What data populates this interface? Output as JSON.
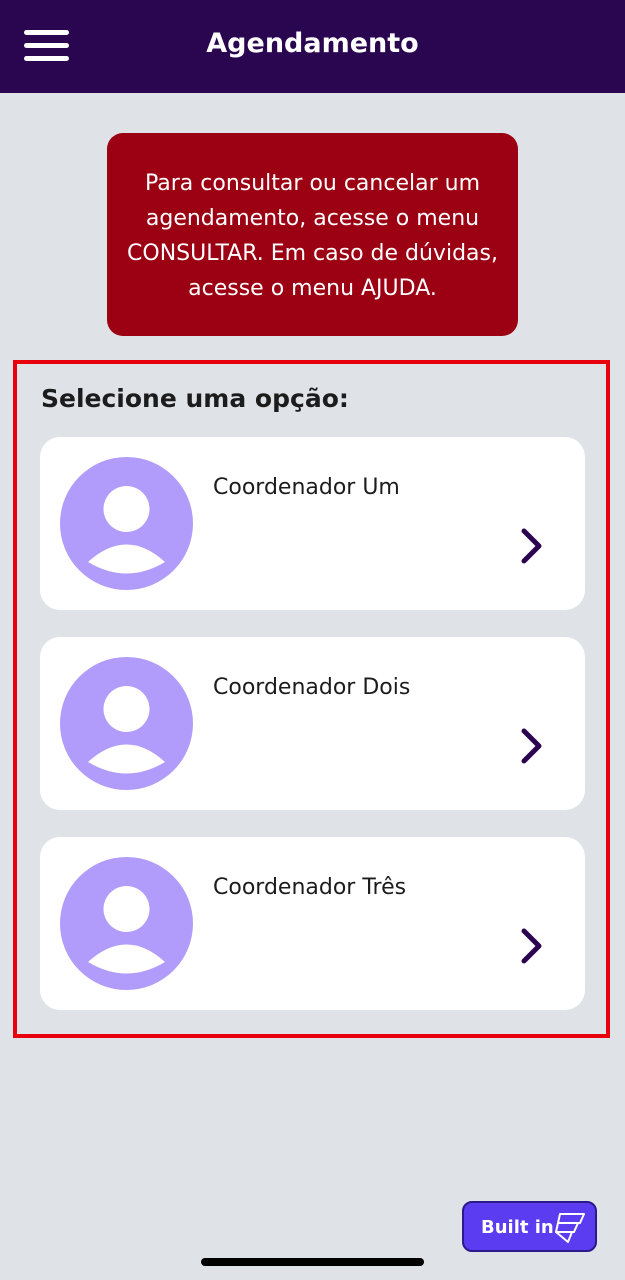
{
  "header": {
    "title": "Agendamento",
    "menu_icon": "hamburger-menu-icon",
    "background": "#2a0550"
  },
  "notice": {
    "text": "Para consultar ou cancelar um agendamento, acesse o menu CONSULTAR. Em caso de dúvidas, acesse o menu AJUDA.",
    "background": "#9b0112"
  },
  "selection": {
    "title": "Selecione uma opção:",
    "highlight_color": "#e8000d",
    "options": [
      {
        "name": "Coordenador Um",
        "avatar_icon": "user-avatar-icon",
        "chevron_icon": "chevron-right-icon"
      },
      {
        "name": "Coordenador Dois",
        "avatar_icon": "user-avatar-icon",
        "chevron_icon": "chevron-right-icon"
      },
      {
        "name": "Coordenador Três",
        "avatar_icon": "user-avatar-icon",
        "chevron_icon": "chevron-right-icon"
      }
    ]
  },
  "badge": {
    "label": "Built in",
    "icon": "builder-logo-icon",
    "background": "#5b3cf0"
  },
  "colors": {
    "page_background": "#dfe2e7",
    "avatar": "#b19cfc",
    "chevron": "#2a0550"
  }
}
